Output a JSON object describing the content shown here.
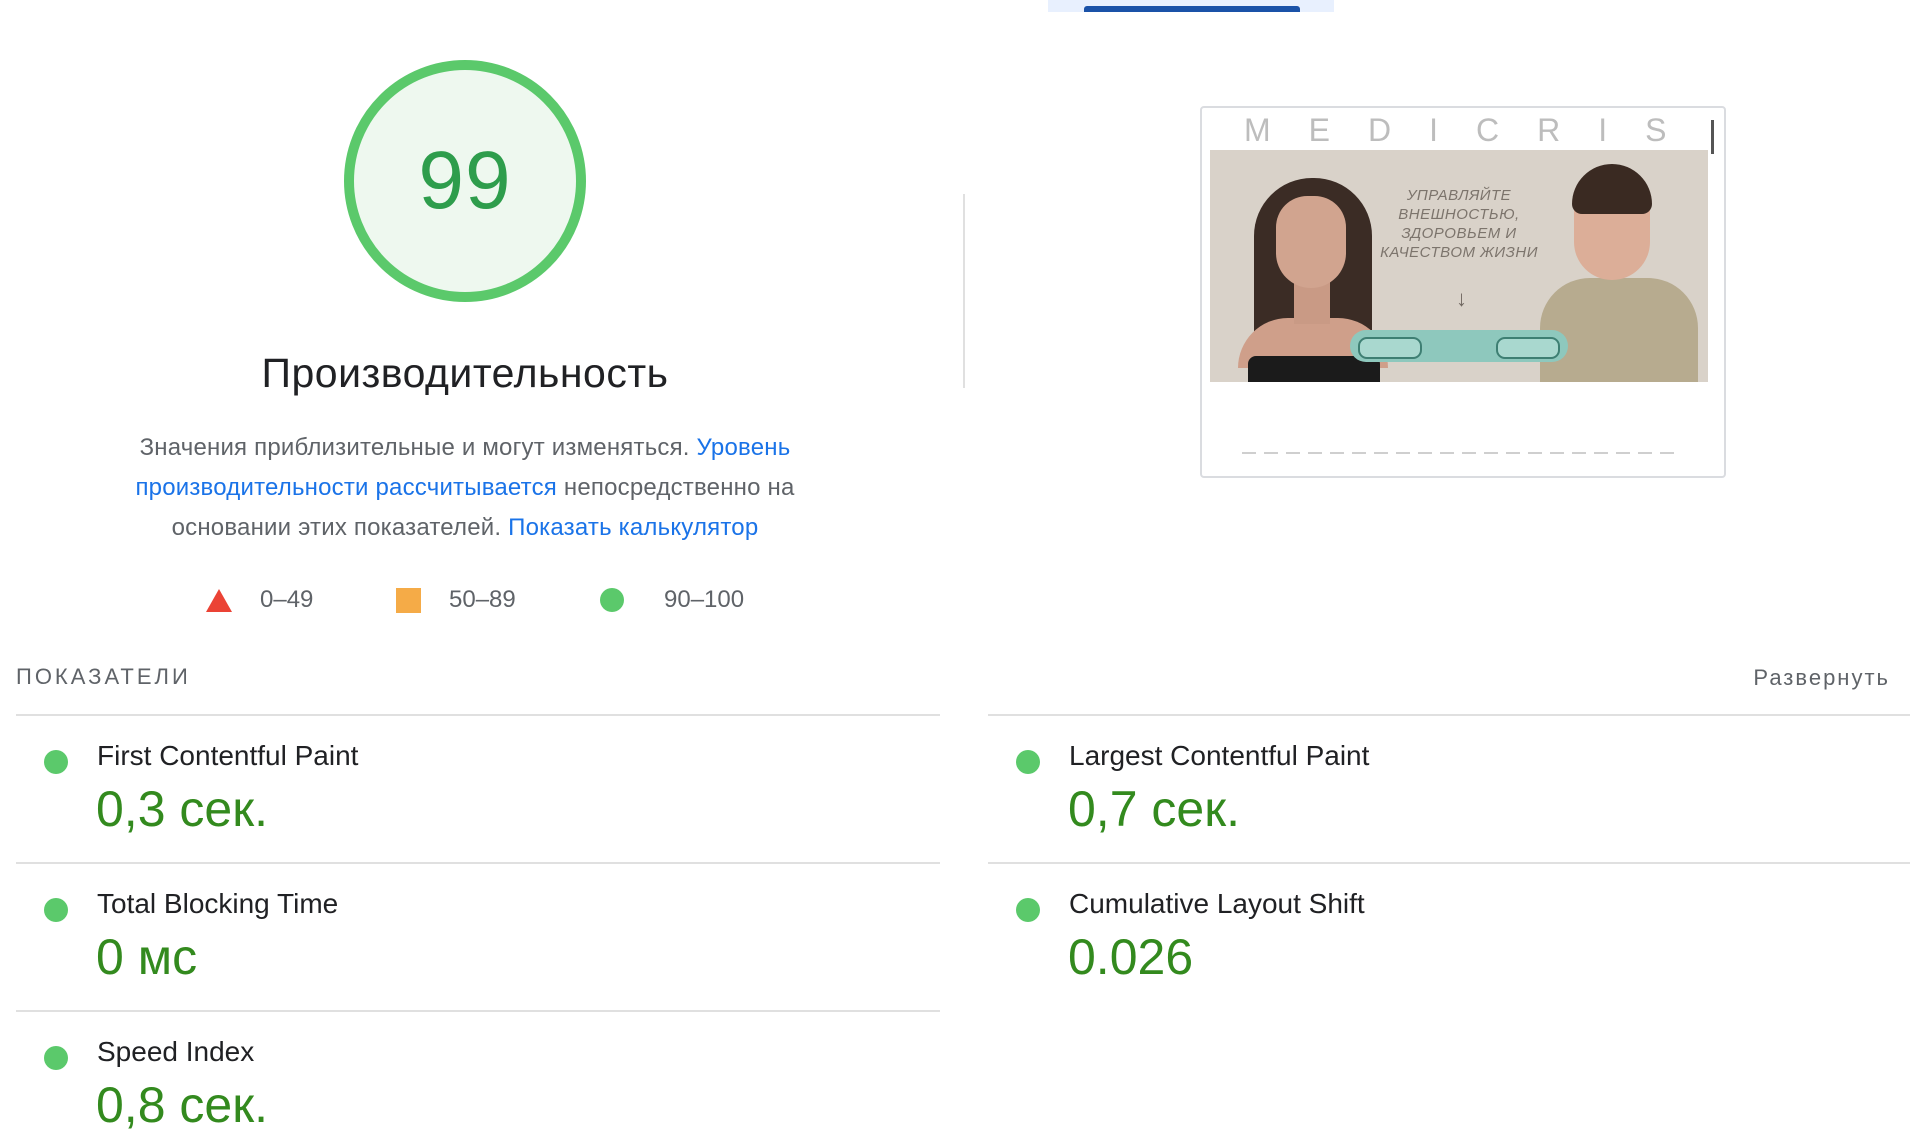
{
  "summary": {
    "score": "99",
    "title": "Производительность",
    "desc_part1": "Значения приблизительные и могут изменяться. ",
    "desc_link1": "Уровень производительности рассчитывается",
    "desc_part2": " непосредственно на основании этих показателей. ",
    "desc_link2": "Показать калькулятор",
    "legend": [
      {
        "label": "0–49",
        "shape": "triangle",
        "color": "#eb4335"
      },
      {
        "label": "50–89",
        "shape": "square",
        "color": "#f5ab47"
      },
      {
        "label": "90–100",
        "shape": "circle",
        "color": "#5bc96b"
      }
    ],
    "score_color": "#5bc96b"
  },
  "screenshot": {
    "logo_text": "MEDICRIS",
    "hero_text": "УПРАВЛЯЙТЕ ВНЕШНОСТЬЮ, ЗДОРОВЬЕМ И КАЧЕСТВОМ ЖИЗНИ",
    "arrow": "↓"
  },
  "metrics": {
    "heading": "ПОКАЗАТЕЛИ",
    "expand_label": "Развернуть",
    "items": [
      {
        "name": "First Contentful Paint",
        "value": "0,3 сек."
      },
      {
        "name": "Largest Contentful Paint",
        "value": "0,7 сек."
      },
      {
        "name": "Total Blocking Time",
        "value": "0 мс"
      },
      {
        "name": "Cumulative Layout Shift",
        "value": "0.026"
      },
      {
        "name": "Speed Index",
        "value": "0,8 сек."
      }
    ],
    "pass_color": "#5bc96b"
  }
}
